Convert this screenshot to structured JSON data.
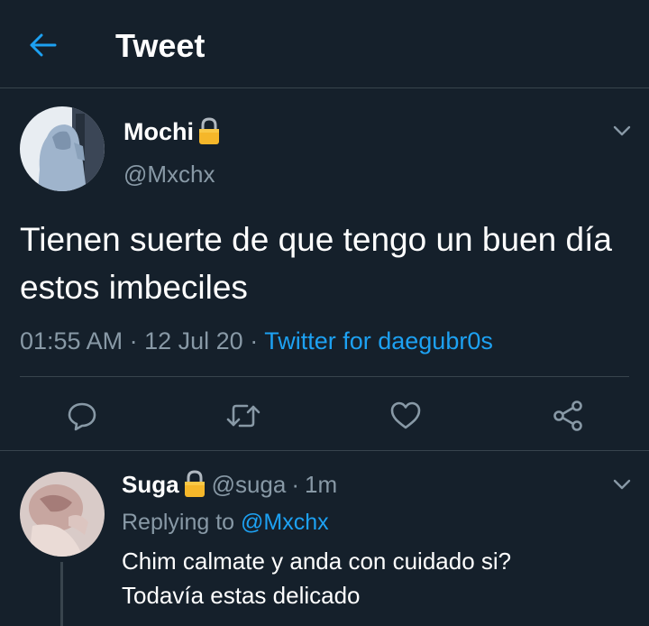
{
  "header": {
    "title": "Tweet",
    "back_icon": "arrow-left-icon",
    "accent": "#1da1f2"
  },
  "tweet": {
    "display_name": "Mochi",
    "handle": "@Mxchx",
    "protected_icon": "lock-icon",
    "text": "Tienen suerte de que tengo un buen día estos imbeciles",
    "time": "01:55 AM",
    "date": "12 Jul 20",
    "source": "Twitter for daegubr0s",
    "menu_icon": "chevron-down-icon",
    "actions": [
      "reply-icon",
      "retweet-icon",
      "like-icon",
      "share-icon"
    ]
  },
  "reply": {
    "display_name": "Suga",
    "handle": "@suga",
    "age": "1m",
    "replying_prefix": "Replying to",
    "replying_to": "@Mxchx",
    "text_line1": "Chim calmate y anda con cuidado si?",
    "text_line2": "Todavía estas delicado"
  },
  "colors": {
    "background": "#15202b",
    "secondary_text": "#8899a6",
    "divider": "#38444d",
    "link": "#1da1f2"
  }
}
